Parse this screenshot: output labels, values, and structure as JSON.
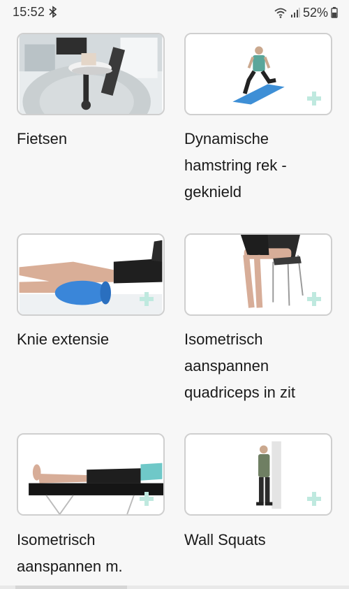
{
  "status_bar": {
    "time": "15:52",
    "battery": "52%",
    "icons": [
      "bluetooth-icon",
      "wifi-icon",
      "signal-icon",
      "battery-icon"
    ]
  },
  "exercises": [
    {
      "title": "Fietsen",
      "image": "stationary-bike"
    },
    {
      "title": "Dynamische hamstring rek - geknield",
      "image": "kneeling-stretch"
    },
    {
      "title": "Knie extensie",
      "image": "knee-extension-roll"
    },
    {
      "title": "Isometrisch aanspannen quadriceps in zit",
      "image": "seated-quadriceps"
    },
    {
      "title": "Isometrisch aanspannen m.",
      "image": "lying-on-table"
    },
    {
      "title": "Wall Squats",
      "image": "wall-squat"
    }
  ],
  "colors": {
    "add_icon": "#bfe9df",
    "background": "#f7f7f7",
    "border": "#cfcfcf"
  }
}
